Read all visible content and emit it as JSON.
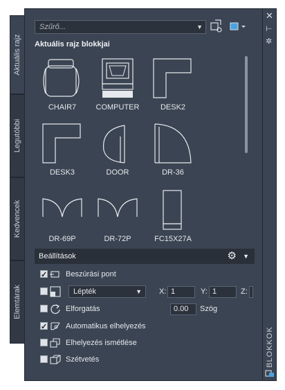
{
  "tabs": [
    "Aktuális rajz",
    "Legutóbbi",
    "Kedvencek",
    "Elemtárak"
  ],
  "filter": {
    "placeholder": "Szűrő..."
  },
  "section_title": "Aktuális rajz blokkjai",
  "blocks": [
    "CHAIR7",
    "COMPUTER",
    "DESK2",
    "DESK3",
    "DOOR",
    "DR-36",
    "DR-69P",
    "DR-72P",
    "FC15X27A"
  ],
  "settings": {
    "header": "Beállítások",
    "insertion_point": {
      "label": "Beszúrási pont",
      "checked": true
    },
    "scale": {
      "value": "Lépték",
      "checked": false
    },
    "x_label": "X:",
    "x_value": "1",
    "y_label": "Y:",
    "y_value": "1",
    "z_label": "Z:",
    "rotation": {
      "label": "Elforgatás",
      "checked": false,
      "value": "0.00",
      "unit": "Szög"
    },
    "auto_place": {
      "label": "Automatikus elhelyezés",
      "checked": true
    },
    "repeat_place": {
      "label": "Elhelyezés ismétlése",
      "checked": false
    },
    "explode": {
      "label": "Szétvetés",
      "checked": false
    }
  },
  "palette_title": "BLOKKOK",
  "icons": [
    "close-icon",
    "pin-icon",
    "properties-icon",
    "insert-block-icon",
    "view-options-icon",
    "gear-icon"
  ]
}
